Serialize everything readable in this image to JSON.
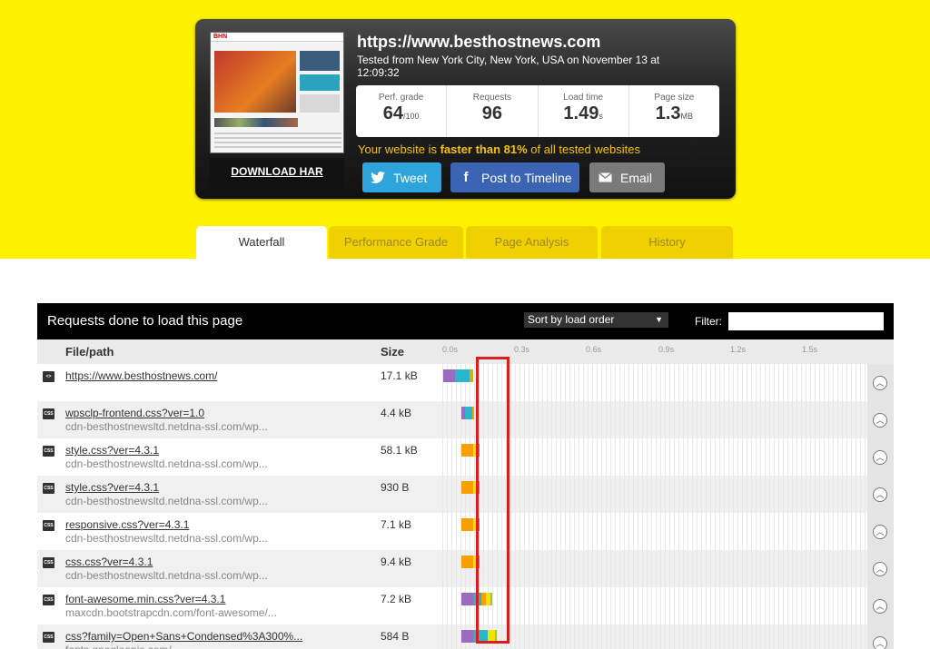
{
  "summary": {
    "url": "https://www.besthostnews.com",
    "tested": "Tested from New York City, New York, USA on November 13 at 12:09:32",
    "thumbnail_logo": "BHN",
    "download_har": "DOWNLOAD HAR",
    "metrics": [
      {
        "label": "Perf. grade",
        "value": "64",
        "unit": "/100"
      },
      {
        "label": "Requests",
        "value": "96",
        "unit": ""
      },
      {
        "label": "Load time",
        "value": "1.49",
        "unit": "s"
      },
      {
        "label": "Page size",
        "value": "1.3",
        "unit": "MB"
      }
    ],
    "faster_prefix": "Your website is ",
    "faster_bold": "faster than 81%",
    "faster_suffix": " of all tested websites",
    "buttons": {
      "tweet": "Tweet",
      "facebook": "Post to Timeline",
      "email": "Email"
    }
  },
  "tabs": [
    "Waterfall",
    "Performance Grade",
    "Page Analysis",
    "History"
  ],
  "waterfall": {
    "title": "Requests done to load this page",
    "sort_selected": "Sort by load order",
    "filter_label": "Filter:",
    "columns": {
      "file": "File/path",
      "size": "Size"
    },
    "ticks": [
      "0.0s",
      "0.3s",
      "0.6s",
      "0.9s",
      "1.2s",
      "1.5s"
    ],
    "rows": [
      {
        "type": "html",
        "name": "https://www.besthostnews.com/",
        "host": "",
        "size": "17.1 kB",
        "start_s": 0.0,
        "segments": [
          {
            "color": "#9b6bbf",
            "dur_s": 0.05
          },
          {
            "color": "#28b6c8",
            "dur_s": 0.06
          },
          {
            "color": "#f5a000",
            "dur_s": 0.008
          },
          {
            "color": "#9dc53a",
            "dur_s": 0.006
          }
        ]
      },
      {
        "type": "css",
        "name": "wpsclp-frontend.css?ver=1.0",
        "host": "cdn-besthostnewsltd.netdna-ssl.com/wp...",
        "size": "4.4 kB",
        "start_s": 0.075,
        "segments": [
          {
            "color": "#9b6bbf",
            "dur_s": 0.015
          },
          {
            "color": "#28b6c8",
            "dur_s": 0.03
          },
          {
            "color": "#f5a000",
            "dur_s": 0.006
          }
        ]
      },
      {
        "type": "css",
        "name": "style.css?ver=4.3.1",
        "host": "cdn-besthostnewsltd.netdna-ssl.com/wp...",
        "size": "58.1 kB",
        "start_s": 0.075,
        "segments": [
          {
            "color": "#f5a000",
            "dur_s": 0.05
          },
          {
            "color": "#f5e200",
            "dur_s": 0.02
          },
          {
            "color": "#9b6bbf",
            "dur_s": 0.005
          }
        ]
      },
      {
        "type": "css",
        "name": "style.css?ver=4.3.1",
        "host": "cdn-besthostnewsltd.netdna-ssl.com/wp...",
        "size": "930 B",
        "start_s": 0.075,
        "segments": [
          {
            "color": "#f5a000",
            "dur_s": 0.05
          },
          {
            "color": "#f5e200",
            "dur_s": 0.02
          },
          {
            "color": "#9b6bbf",
            "dur_s": 0.005
          }
        ]
      },
      {
        "type": "css",
        "name": "responsive.css?ver=4.3.1",
        "host": "cdn-besthostnewsltd.netdna-ssl.com/wp...",
        "size": "7.1 kB",
        "start_s": 0.075,
        "segments": [
          {
            "color": "#f5a000",
            "dur_s": 0.05
          },
          {
            "color": "#f5e200",
            "dur_s": 0.02
          },
          {
            "color": "#9b6bbf",
            "dur_s": 0.005
          }
        ]
      },
      {
        "type": "css",
        "name": "css.css?ver=4.3.1",
        "host": "cdn-besthostnewsltd.netdna-ssl.com/wp...",
        "size": "9.4 kB",
        "start_s": 0.075,
        "segments": [
          {
            "color": "#f5a000",
            "dur_s": 0.05
          },
          {
            "color": "#f5e200",
            "dur_s": 0.02
          },
          {
            "color": "#9b6bbf",
            "dur_s": 0.005
          }
        ]
      },
      {
        "type": "css",
        "name": "font-awesome.min.css?ver=4.3.1",
        "host": "maxcdn.bootstrapcdn.com/font-awesome/...",
        "size": "7.2 kB",
        "start_s": 0.075,
        "segments": [
          {
            "color": "#9b6bbf",
            "dur_s": 0.05
          },
          {
            "color": "#28b6c8",
            "dur_s": 0.035
          },
          {
            "color": "#f5a000",
            "dur_s": 0.02
          },
          {
            "color": "#f5e200",
            "dur_s": 0.02
          },
          {
            "color": "#9dc53a",
            "dur_s": 0.006
          }
        ]
      },
      {
        "type": "css",
        "name": "css?family=Open+Sans+Condensed%3A300%...",
        "host": "fonts.googleapis.com/",
        "size": "584 B",
        "start_s": 0.075,
        "segments": [
          {
            "color": "#9b6bbf",
            "dur_s": 0.05
          },
          {
            "color": "#28b6c8",
            "dur_s": 0.06
          },
          {
            "color": "#f5e200",
            "dur_s": 0.03
          },
          {
            "color": "#9dc53a",
            "dur_s": 0.006
          }
        ]
      }
    ]
  },
  "colors": {
    "brand_yellow": "#fff200",
    "highlight": "#d81e1e"
  }
}
